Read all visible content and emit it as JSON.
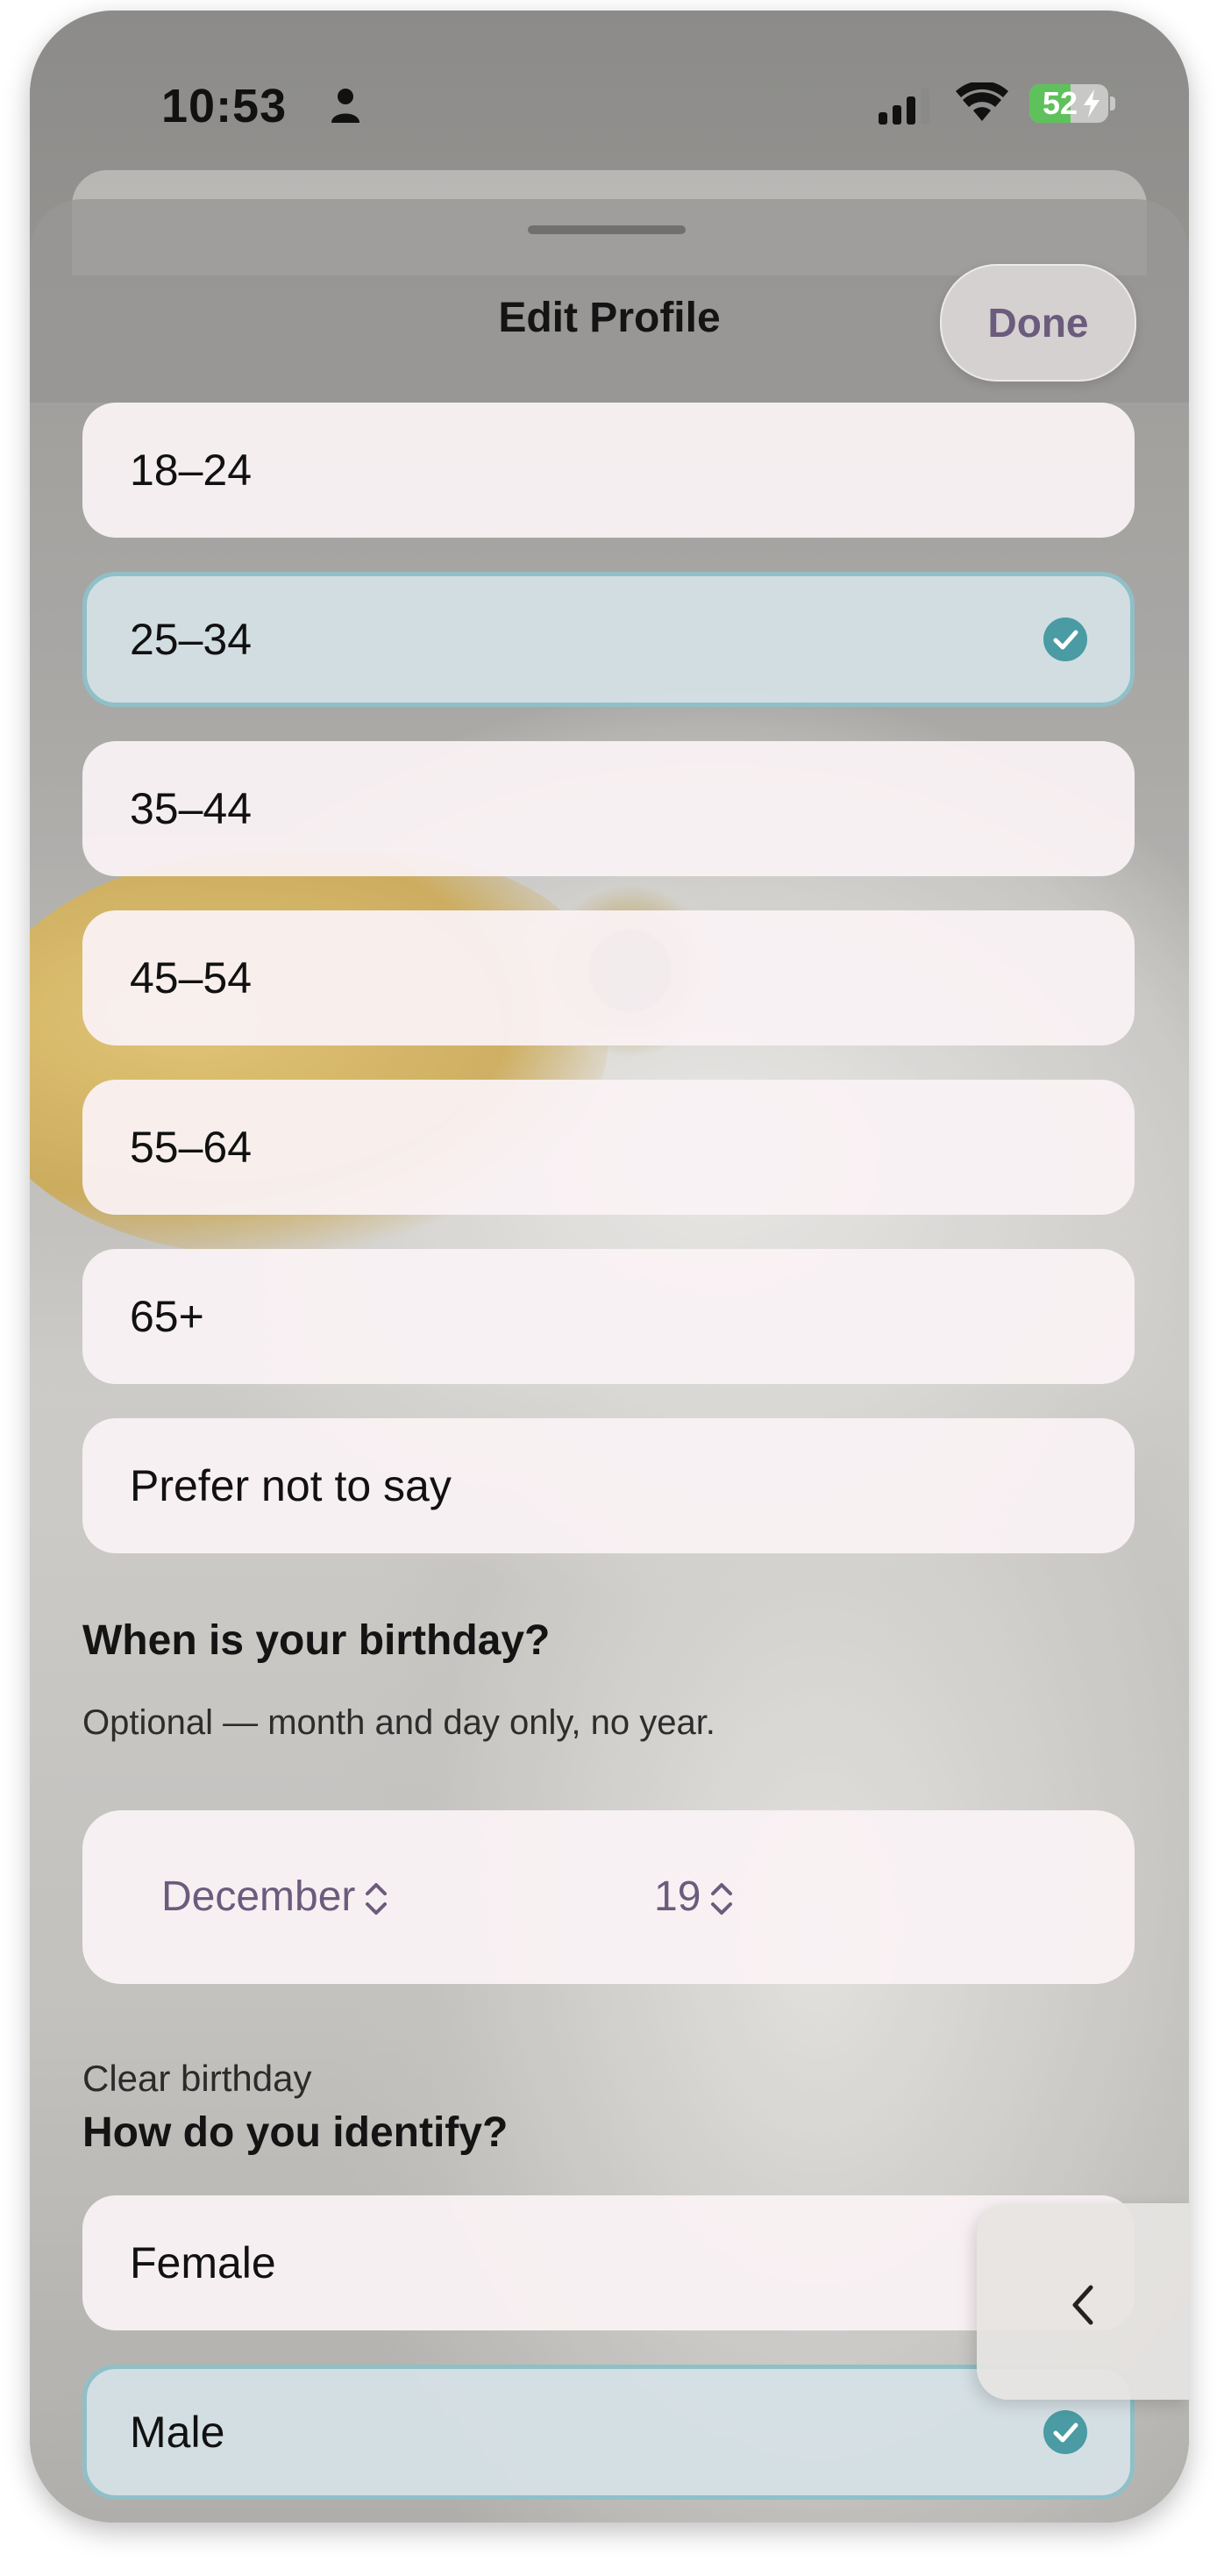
{
  "status_bar": {
    "time": "10:53",
    "battery_level": "52",
    "battery_fraction": 0.52,
    "icons": [
      "person-icon",
      "signal-icon",
      "wifi-icon",
      "battery-charging-icon"
    ]
  },
  "sheet": {
    "title": "Edit Profile",
    "done_label": "Done"
  },
  "age_options": [
    {
      "label": "18–24",
      "selected": false
    },
    {
      "label": "25–34",
      "selected": true
    },
    {
      "label": "35–44",
      "selected": false
    },
    {
      "label": "45–54",
      "selected": false
    },
    {
      "label": "55–64",
      "selected": false
    },
    {
      "label": "65+",
      "selected": false
    },
    {
      "label": "Prefer not to say",
      "selected": false
    }
  ],
  "birthday": {
    "heading": "When is your birthday?",
    "subtext": "Optional — month and day only, no year.",
    "month": "December",
    "day": "19",
    "clear_label": "Clear birthday"
  },
  "identity": {
    "heading": "How do you identify?",
    "options": [
      {
        "label": "Female",
        "selected": false
      },
      {
        "label": "Male",
        "selected": true
      }
    ]
  },
  "colors": {
    "accent": "#6b5b7d",
    "selected_border": "#8fc0c8",
    "check": "#4a9ba3"
  }
}
